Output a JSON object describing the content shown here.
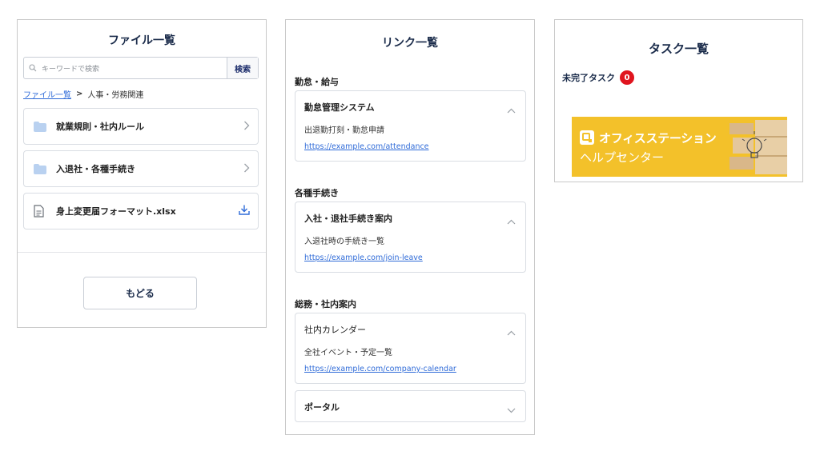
{
  "files_panel": {
    "title": "ファイル一覧",
    "search": {
      "placeholder": "キーワードで検索",
      "button_label": "検索"
    },
    "breadcrumb": {
      "root": "ファイル一覧",
      "separator": ">",
      "current": "人事・労務関連"
    },
    "items": [
      {
        "type": "folder",
        "label": "就業規則・社内ルール",
        "icon": "folder-icon",
        "action_icon": "chevron-right-icon"
      },
      {
        "type": "folder",
        "label": "入退社・各種手続き",
        "icon": "folder-icon",
        "action_icon": "chevron-right-icon"
      },
      {
        "type": "file",
        "label": "身上変更届フォーマット.xlsx",
        "icon": "document-icon",
        "action_icon": "download-icon"
      }
    ],
    "back_button": "もどる"
  },
  "links_panel": {
    "title": "リンク一覧",
    "sections": [
      {
        "heading": "勤怠・給与",
        "cards": [
          {
            "title": "勤怠管理システム",
            "expanded": true,
            "description": "出退勤打刻・勤怠申請",
            "url": "https://example.com/attendance"
          }
        ]
      },
      {
        "heading": "各種手続き",
        "cards": [
          {
            "title": "入社・退社手続き案内",
            "expanded": true,
            "description": "入退社時の手続き一覧",
            "url": "https://example.com/join-leave"
          }
        ]
      },
      {
        "heading": "総務・社内案内",
        "cards": [
          {
            "title": "社内カレンダー",
            "expanded": true,
            "description": "全社イベント・予定一覧",
            "url": "https://example.com/company-calendar"
          },
          {
            "title": "ポータル",
            "expanded": false
          }
        ]
      }
    ]
  },
  "tasks_panel": {
    "title": "タスク一覧",
    "incomplete_label": "未完了タスク",
    "incomplete_count": "0",
    "banner": {
      "brand": "オフィスステーション",
      "subtitle": "ヘルプセンター"
    }
  },
  "colors": {
    "accent_link": "#2f6bd8",
    "badge_red": "#e0141e",
    "banner_yellow": "#f3c12a",
    "folder_blue": "#b9d1f0",
    "heading_navy": "#1a2b4a"
  }
}
